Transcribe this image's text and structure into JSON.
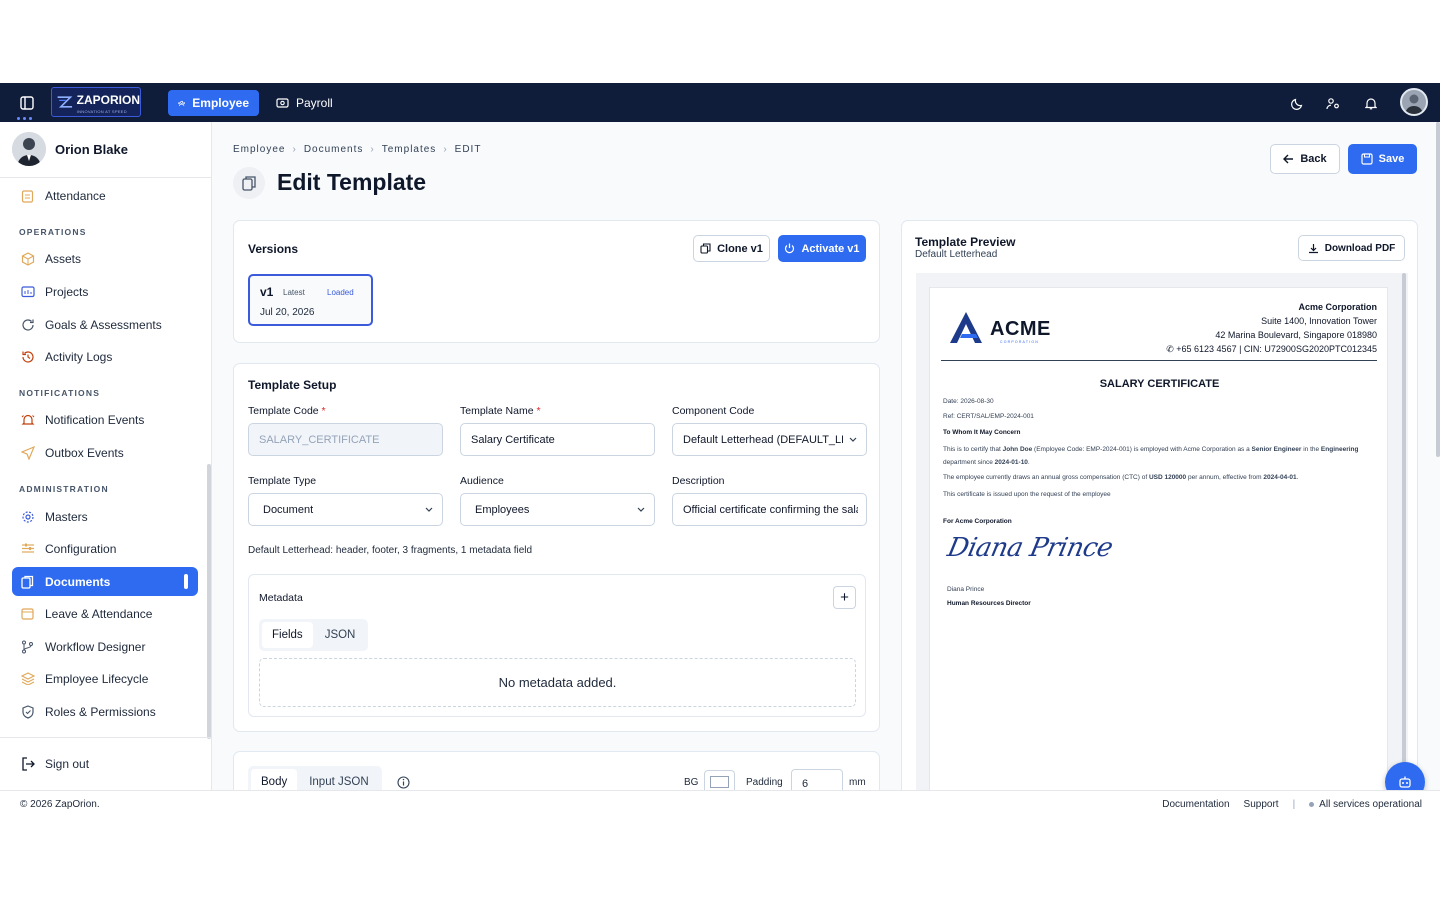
{
  "topbar": {
    "logo_title": "ZAPORION",
    "logo_sub": "INNOVATION AT SPEED",
    "nav": [
      {
        "label": "Employee",
        "icon": "users-icon",
        "active": true
      },
      {
        "label": "Payroll",
        "icon": "money-icon",
        "active": false
      }
    ]
  },
  "sidebar": {
    "user_name": "Orion Blake",
    "top_item": "Attendance",
    "sections": [
      {
        "title": "OPERATIONS",
        "items": [
          "Assets",
          "Projects",
          "Goals & Assessments",
          "Activity Logs"
        ]
      },
      {
        "title": "NOTIFICATIONS",
        "items": [
          "Notification Events",
          "Outbox Events"
        ]
      },
      {
        "title": "ADMINISTRATION",
        "items": [
          "Masters",
          "Configuration",
          "Documents",
          "Leave & Attendance",
          "Workflow Designer",
          "Employee Lifecycle",
          "Roles & Permissions"
        ]
      }
    ],
    "active_item": "Documents",
    "sign_out": "Sign out"
  },
  "breadcrumb": [
    "Employee",
    "Documents",
    "Templates",
    "EDIT"
  ],
  "page_title": "Edit Template",
  "actions": {
    "back": "Back",
    "save": "Save"
  },
  "versions": {
    "title": "Versions",
    "clone": "Clone v1",
    "activate": "Activate v1",
    "item": {
      "version": "v1",
      "latest": "Latest",
      "loaded": "Loaded",
      "date": "Jul 20, 2026"
    }
  },
  "setup": {
    "title": "Template Setup",
    "template_code_label": "Template Code",
    "template_code": "SALARY_CERTIFICATE",
    "template_name_label": "Template Name",
    "template_name": "Salary Certificate",
    "component_code_label": "Component Code",
    "component_code": "Default Letterhead (DEFAULT_LETTERHEAD)",
    "template_type_label": "Template Type",
    "template_type": "Document",
    "audience_label": "Audience",
    "audience": "Employees",
    "description_label": "Description",
    "description": "Official certificate confirming the salary",
    "required_mark": "*",
    "summary": "Default Letterhead: header, footer, 3 fragments, 1 metadata field"
  },
  "metadata": {
    "title": "Metadata",
    "tabs": [
      "Fields",
      "JSON"
    ],
    "empty": "No metadata added.",
    "add": "+"
  },
  "body_card": {
    "tabs": [
      "Body",
      "Input JSON"
    ],
    "bg_label": "BG",
    "padding_label": "Padding",
    "padding_value": "6",
    "unit": "mm"
  },
  "preview": {
    "title": "Template Preview",
    "subtitle": "Default Letterhead",
    "download": "Download PDF",
    "doc": {
      "company_logo": "ACME",
      "company_logo_sub": "CORPORATION",
      "company": "Acme Corporation",
      "addr1": "Suite 1400, Innovation Tower",
      "addr2": "42 Marina Boulevard, Singapore 018980",
      "contact": "+65 6123 4567 | CIN: U72900SG2020PTC012345",
      "heading": "SALARY CERTIFICATE",
      "date": "Date: 2026-08-30",
      "ref": "Ref: CERT/SAL/EMP-2024-001",
      "salutation": "To Whom It May Concern",
      "p1_a": "This is to certify that ",
      "p1_name": "John Doe",
      "p1_b": " (Employee Code: EMP-2024-001) is employed with Acme Corporation as a ",
      "p1_role": "Senior Engineer",
      "p1_c": " in the ",
      "p1_dept": "Engineering",
      "p1_d": " department since ",
      "p1_since": "2024-01-10",
      "p1_e": ".",
      "p2_a": "The employee currently draws an annual gross compensation (CTC) of ",
      "p2_amt": "USD 120000",
      "p2_b": " per annum, effective from ",
      "p2_date": "2024-04-01",
      "p2_c": ".",
      "p3": "This certificate is issued upon the request of the employee",
      "for": "For Acme Corporation",
      "signature": "Diana Prince",
      "signer": "Diana Prince",
      "signer_title": "Human Resources Director"
    }
  },
  "footer": {
    "copyright": "© 2026 ZapOrion.",
    "links": [
      "Documentation",
      "Support"
    ],
    "status": "All services operational"
  },
  "colors": {
    "primary": "#2f6bf0",
    "topbar": "#0f1c3a"
  }
}
